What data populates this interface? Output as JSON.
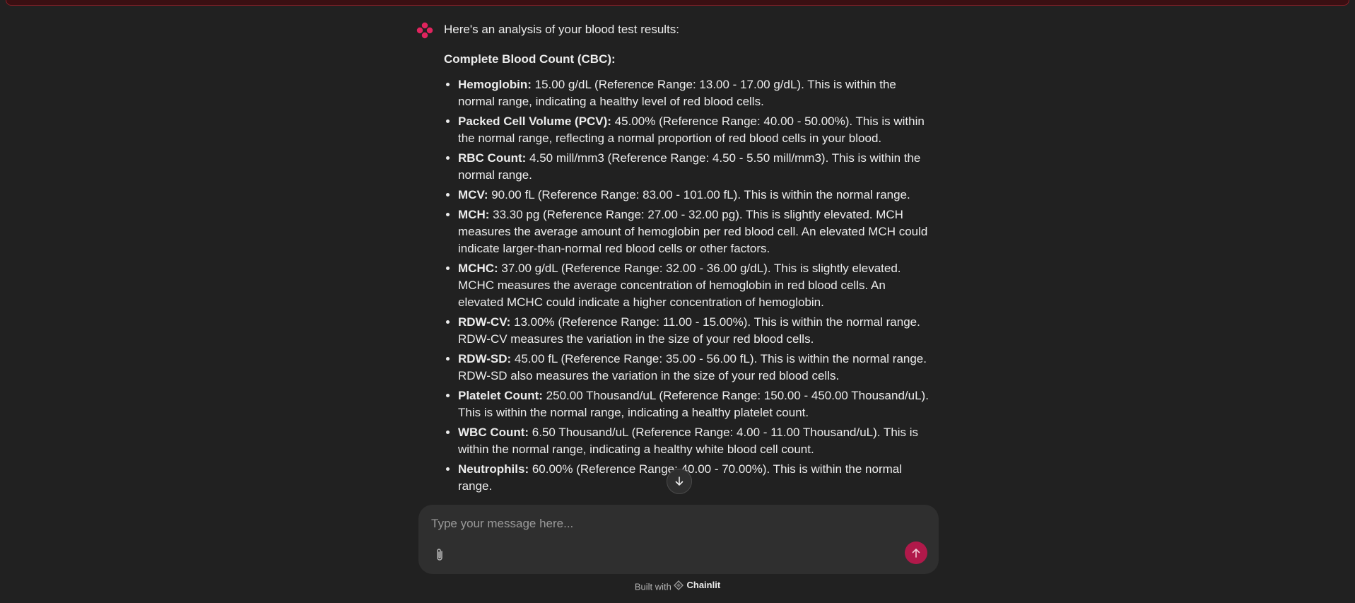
{
  "assistant": {
    "avatar_icon": "chainlit-logo-icon",
    "accent_color": "#e0245e",
    "intro": "Here's an analysis of your blood test results:",
    "section_title": "Complete Blood Count (CBC):",
    "results": [
      {
        "label": "Hemoglobin:",
        "text": " 15.00 g/dL (Reference Range: 13.00 - 17.00 g/dL). This is within the normal range, indicating a healthy level of red blood cells."
      },
      {
        "label": "Packed Cell Volume (PCV):",
        "text": " 45.00% (Reference Range: 40.00 - 50.00%). This is within the normal range, reflecting a normal proportion of red blood cells in your blood."
      },
      {
        "label": "RBC Count:",
        "text": " 4.50 mill/mm3 (Reference Range: 4.50 - 5.50 mill/mm3). This is within the normal range."
      },
      {
        "label": "MCV:",
        "text": " 90.00 fL (Reference Range: 83.00 - 101.00 fL). This is within the normal range."
      },
      {
        "label": "MCH:",
        "text": " 33.30 pg (Reference Range: 27.00 - 32.00 pg). This is slightly elevated. MCH measures the average amount of hemoglobin per red blood cell. An elevated MCH could indicate larger-than-normal red blood cells or other factors."
      },
      {
        "label": "MCHC:",
        "text": " 37.00 g/dL (Reference Range: 32.00 - 36.00 g/dL). This is slightly elevated. MCHC measures the average concentration of hemoglobin in red blood cells. An elevated MCHC could indicate a higher concentration of hemoglobin."
      },
      {
        "label": "RDW-CV:",
        "text": " 13.00% (Reference Range: 11.00 - 15.00%). This is within the normal range. RDW-CV measures the variation in the size of your red blood cells."
      },
      {
        "label": "RDW-SD:",
        "text": " 45.00 fL (Reference Range: 35.00 - 56.00 fL). This is within the normal range. RDW-SD also measures the variation in the size of your red blood cells."
      },
      {
        "label": "Platelet Count:",
        "text": " 250.00 Thousand/uL (Reference Range: 150.00 - 450.00 Thousand/uL). This is within the normal range, indicating a healthy platelet count."
      },
      {
        "label": "WBC Count:",
        "text": " 6.50 Thousand/uL (Reference Range: 4.00 - 11.00 Thousand/uL). This is within the normal range, indicating a healthy white blood cell count."
      },
      {
        "label": "Neutrophils:",
        "text": " 60.00% (Reference Range: 40.00 - 70.00%). This is within the normal range."
      }
    ]
  },
  "scroll_button": {
    "icon": "arrow-down-icon"
  },
  "composer": {
    "placeholder": "Type your message here...",
    "attach_icon": "paperclip-icon",
    "send_icon": "arrow-up-icon",
    "send_color": "#b0194a"
  },
  "footer": {
    "built_with": "Built with",
    "brand": "Chainlit"
  }
}
